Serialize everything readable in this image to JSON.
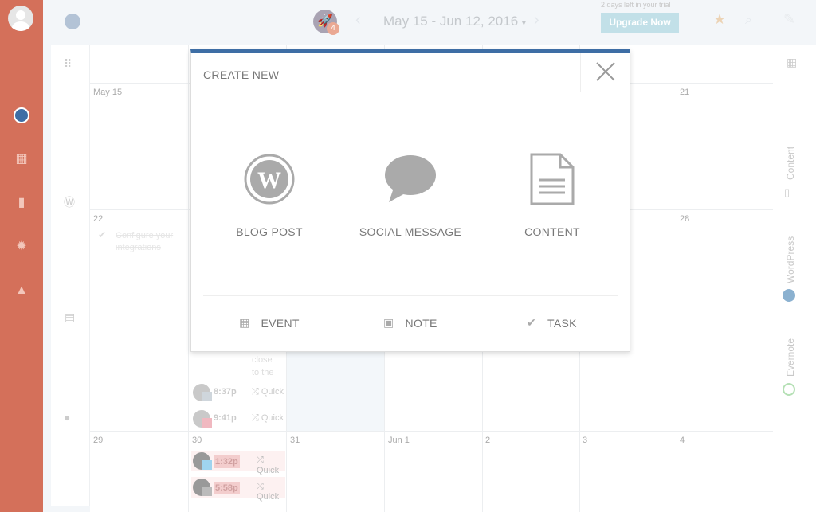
{
  "header": {
    "date_range": "May 15 - Jun 12, 2016",
    "notification_count": "4",
    "trial_text": "2 days left in your trial",
    "upgrade_label": "Upgrade Now"
  },
  "calendar": {
    "days": [
      {
        "label": "May 15"
      },
      {
        "label": "21"
      },
      {
        "label": "22"
      },
      {
        "label": "28"
      },
      {
        "label": "29"
      },
      {
        "label": "30"
      },
      {
        "label": "31"
      },
      {
        "label": "Jun 1"
      },
      {
        "label": "2"
      },
      {
        "label": "3"
      },
      {
        "label": "4"
      }
    ],
    "task": "Configure your integrations",
    "partial_text": [
      "close",
      "to the"
    ],
    "posts": [
      {
        "time": "8:37p",
        "label": "Quick",
        "network": "share"
      },
      {
        "time": "9:41p",
        "label": "Quick",
        "network": "pinterest"
      },
      {
        "time": "1:32p",
        "label": "Quick",
        "network": "twitter"
      },
      {
        "time": "5:58p",
        "label": "Quick",
        "network": "share"
      }
    ]
  },
  "right_panel": {
    "items": [
      "Content",
      "WordPress",
      "Evernote"
    ]
  },
  "modal": {
    "title": "CREATE NEW",
    "options": [
      "BLOG POST",
      "SOCIAL MESSAGE",
      "CONTENT"
    ],
    "small_options": [
      "EVENT",
      "NOTE",
      "TASK"
    ]
  },
  "colors": {
    "sidebar": "#d4705a",
    "accent": "#3e6ea5",
    "upgrade": "#c2e0e8"
  }
}
